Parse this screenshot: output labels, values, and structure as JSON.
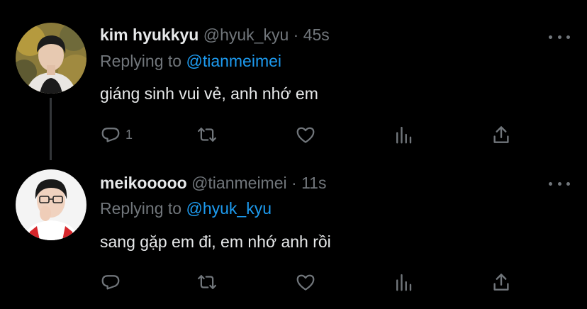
{
  "tweets": [
    {
      "name": "kim hyukkyu",
      "handle": "@hyuk_kyu",
      "separator": "·",
      "time": "45s",
      "replying_prefix": "Replying to",
      "replying_to": "@tianmeimei",
      "text": "giáng sinh vui vẻ, anh nhớ em",
      "reply_count": "1",
      "retweet_count": "",
      "like_count": ""
    },
    {
      "name": "meikooooo",
      "handle": "@tianmeimei",
      "separator": "·",
      "time": "11s",
      "replying_prefix": "Replying to",
      "replying_to": "@hyuk_kyu",
      "text": "sang gặp em đi, em nhớ anh rồi",
      "reply_count": "",
      "retweet_count": "",
      "like_count": ""
    }
  ],
  "icons": {
    "reply": "reply-icon",
    "retweet": "retweet-icon",
    "like": "heart-icon",
    "analytics": "analytics-icon",
    "share": "share-icon",
    "more": "more-icon"
  },
  "colors": {
    "background": "#000000",
    "text": "#e7e9ea",
    "secondary": "#71767b",
    "link": "#1d9bf0",
    "thread_line": "#333639"
  }
}
